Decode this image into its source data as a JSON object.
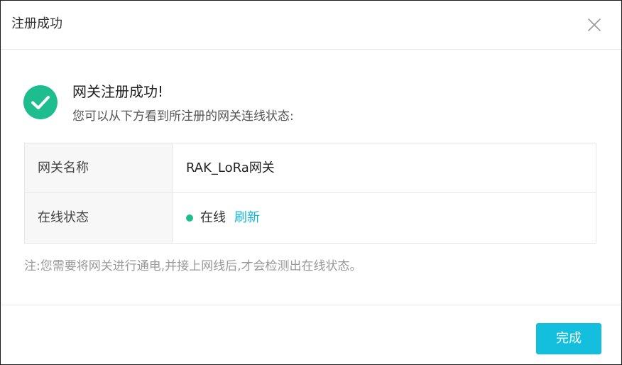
{
  "dialog": {
    "title": "注册成功"
  },
  "success": {
    "icon": "check-circle-icon",
    "title": "网关注册成功!",
    "description": "您可以从下方看到所注册的网关连线状态:"
  },
  "info": {
    "rows": [
      {
        "label": "网关名称",
        "value": "RAK_LoRa网关"
      },
      {
        "label": "在线状态",
        "status": "在线",
        "refresh": "刷新"
      }
    ]
  },
  "note": "注:您需要将网关进行通电,并接上网线后,才会检测出在线状态。",
  "footer": {
    "done_label": "完成"
  },
  "colors": {
    "accent": "#13bfdc",
    "success": "#1ebd8f",
    "link": "#13b5d6"
  }
}
